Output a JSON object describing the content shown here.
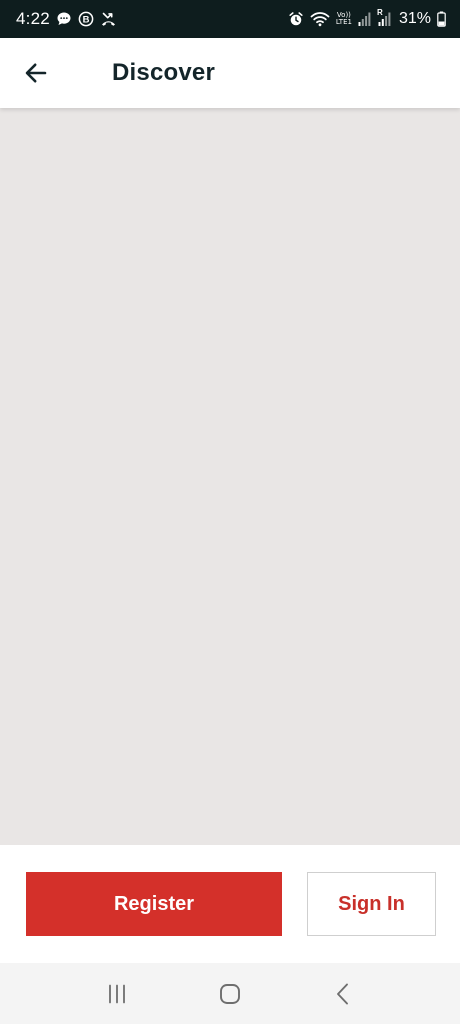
{
  "status_bar": {
    "time": "4:22",
    "battery": "31%",
    "left_icons": [
      "chat-bubble-icon",
      "b-badge-icon",
      "missed-call-icon"
    ],
    "right_icons": [
      "alarm-icon",
      "wifi-icon",
      "volte-icon",
      "signal-icon",
      "signal-r-icon",
      "battery-icon"
    ],
    "volte_top": "Vo))",
    "volte_bottom": "LTE1",
    "signal_roaming": "R"
  },
  "app_bar": {
    "title": "Discover",
    "back_icon": "arrow-left-icon"
  },
  "actions": {
    "register_label": "Register",
    "signin_label": "Sign In"
  },
  "nav_bar": {
    "icons": [
      "recent-apps-icon",
      "home-icon",
      "back-chevron-icon"
    ]
  },
  "colors": {
    "status_bg": "#0e1d1e",
    "content_bg": "#e9e6e5",
    "primary_red": "#d4302a",
    "title_text": "#14252a",
    "nav_bg": "#f4f4f4"
  }
}
